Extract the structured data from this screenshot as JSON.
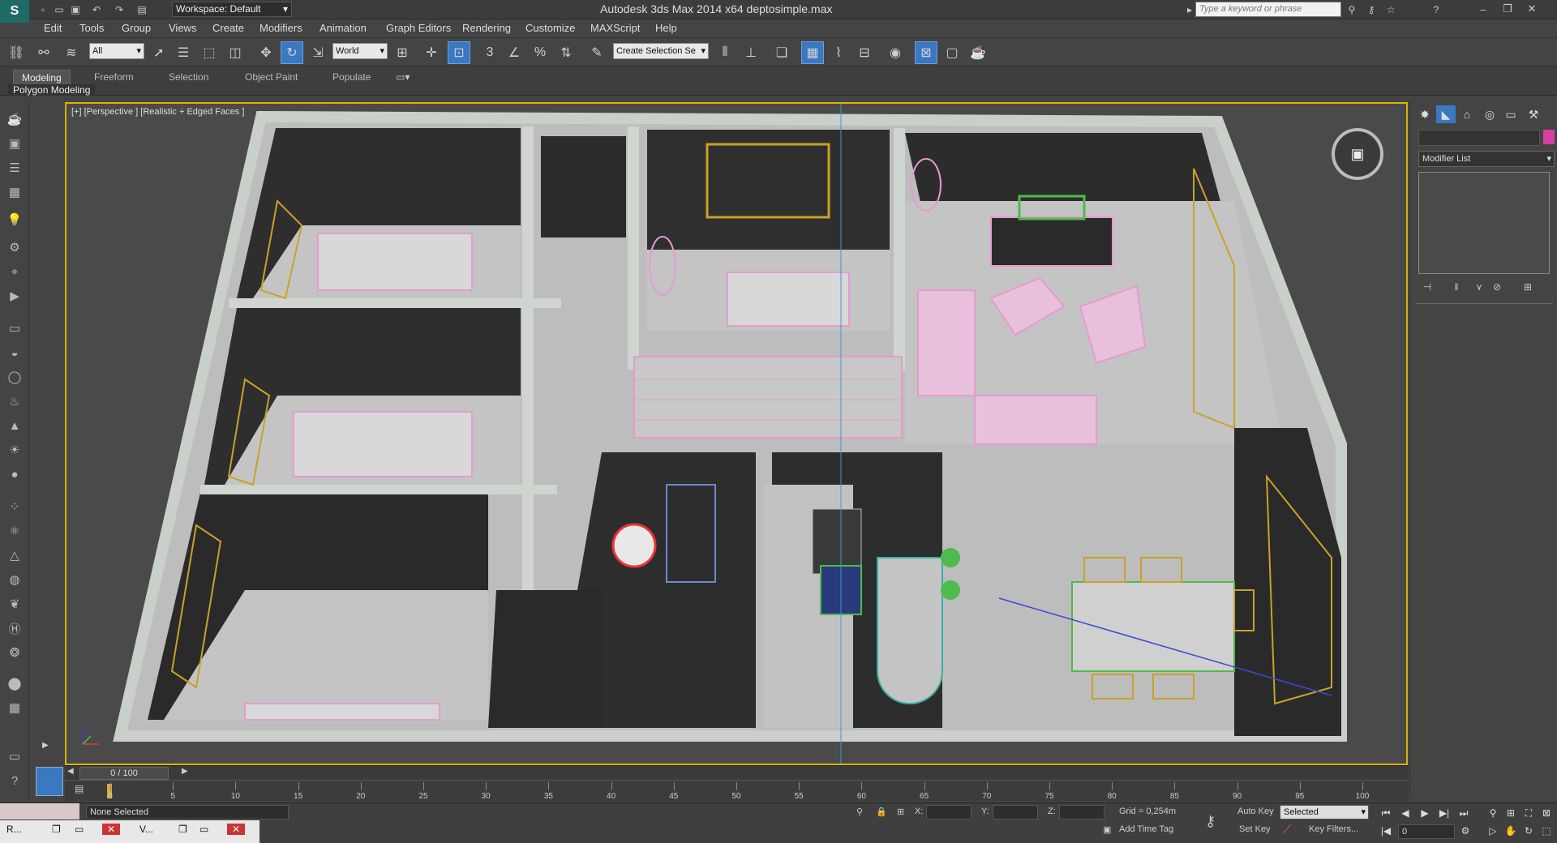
{
  "title_bar": {
    "app_logo": "S",
    "workspace_label": "Workspace: Default",
    "window_title": "Autodesk 3ds Max  2014 x64      deptosimple.max",
    "search_placeholder": "Type a keyword or phrase",
    "help_label": "?"
  },
  "menu": [
    "Edit",
    "Tools",
    "Group",
    "Views",
    "Create",
    "Modifiers",
    "Animation",
    "Graph Editors",
    "Rendering",
    "Customize",
    "MAXScript",
    "Help"
  ],
  "toolbar": {
    "selection_filter": "All",
    "reference_coord": "World",
    "named_selection_placeholder": "Create Selection Se",
    "snap_3": "3",
    "snap_percent": "%"
  },
  "ribbon": {
    "tabs": [
      "Modeling",
      "Freeform",
      "Selection",
      "Object Paint",
      "Populate"
    ],
    "active_tab": "Modeling",
    "sub_label": "Polygon Modeling"
  },
  "viewport": {
    "label": "[+] [Perspective ] [Realistic + Edged Faces ]"
  },
  "command_panel": {
    "modifier_list": "Modifier List",
    "accent_color": "#d63fa2"
  },
  "timeline": {
    "readout": "0 / 100",
    "ticks": [
      "0",
      "5",
      "10",
      "15",
      "20",
      "25",
      "30",
      "35",
      "40",
      "45",
      "50",
      "55",
      "60",
      "65",
      "70",
      "75",
      "80",
      "85",
      "90",
      "95",
      "100"
    ]
  },
  "status": {
    "selection": "None Selected",
    "x_label": "X:",
    "y_label": "Y:",
    "z_label": "Z:",
    "grid": "Grid = 0,254m",
    "add_time_tag": "Add Time Tag",
    "auto_key": "Auto Key",
    "set_key": "Set Key",
    "key_selected": "Selected",
    "key_filters": "Key Filters...",
    "frame": "0"
  },
  "taskbar": {
    "item1": "R...",
    "item2": "V..."
  },
  "colors": {
    "viewport_border": "#d8b400",
    "active_blue": "#3a78c2",
    "wall": "#c9cfc9",
    "floor": "#bdbdbd",
    "furniture_pink": "#e59bd0",
    "window_yellow": "#c9a227"
  }
}
